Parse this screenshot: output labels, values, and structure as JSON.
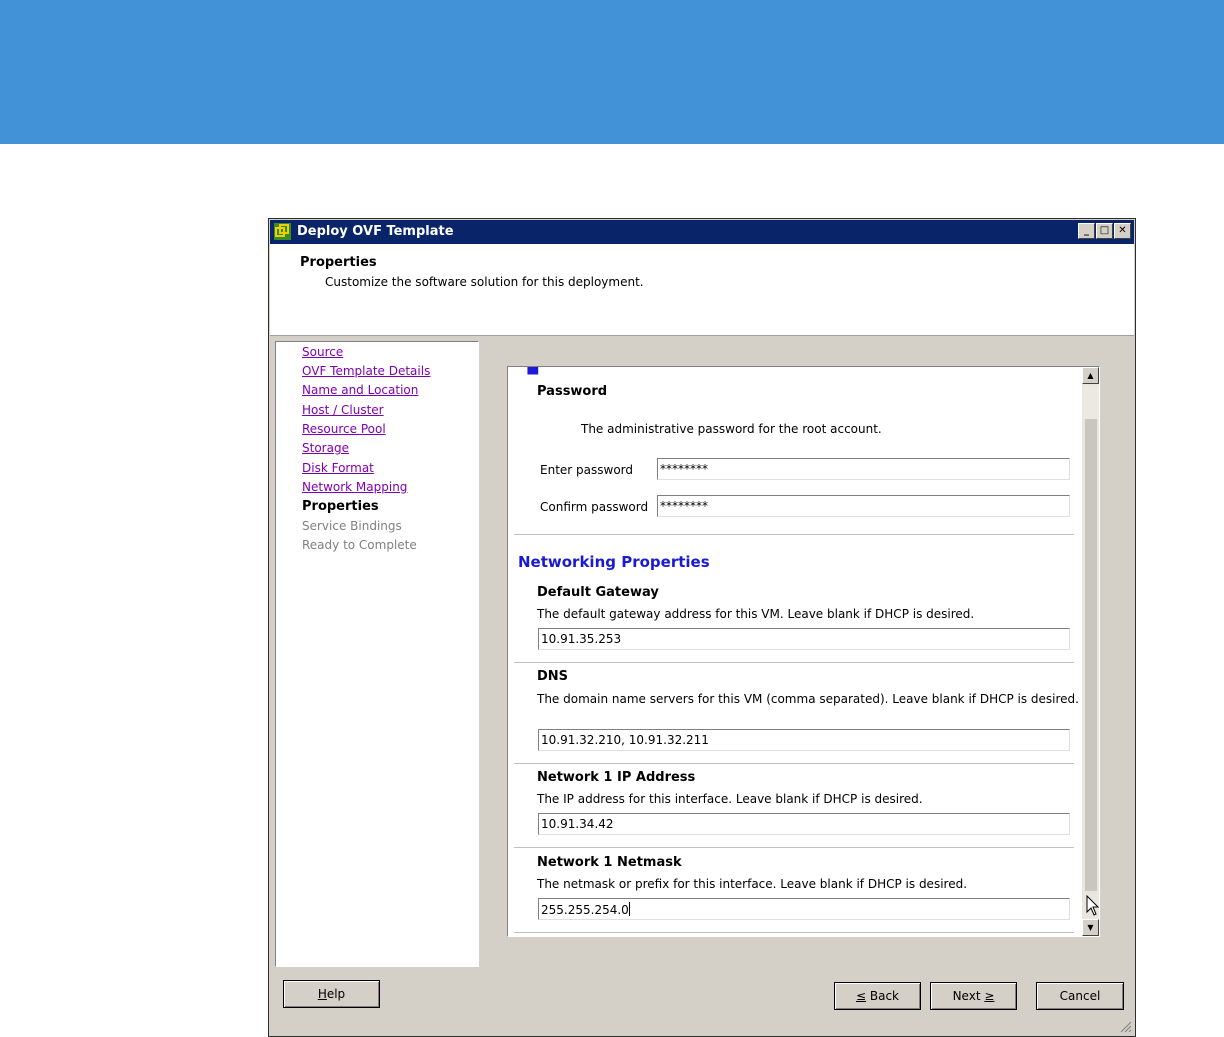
{
  "window": {
    "title": "Deploy OVF Template"
  },
  "titlebar": {
    "minimize": "_",
    "maximize": "□",
    "close": "✕"
  },
  "header": {
    "title": "Properties",
    "subtitle": "Customize the software solution for this deployment."
  },
  "nav": {
    "items": [
      {
        "label": "Source",
        "state": "visited"
      },
      {
        "label": "OVF Template Details",
        "state": "visited"
      },
      {
        "label": "Name and Location",
        "state": "visited"
      },
      {
        "label": "Host / Cluster",
        "state": "visited"
      },
      {
        "label": "Resource Pool",
        "state": "visited"
      },
      {
        "label": "Storage",
        "state": "visited"
      },
      {
        "label": "Disk Format",
        "state": "visited"
      },
      {
        "label": "Network Mapping",
        "state": "visited"
      },
      {
        "label": "Properties",
        "state": "current"
      },
      {
        "label": "Service Bindings",
        "state": "pending"
      },
      {
        "label": "Ready to Complete",
        "state": "pending"
      }
    ]
  },
  "password": {
    "title": "Password",
    "description": "The administrative password for the root account.",
    "enter_label": "Enter password",
    "enter_value": "********",
    "confirm_label": "Confirm password",
    "confirm_value": "********"
  },
  "networking": {
    "section_title": "Networking Properties",
    "gateway": {
      "title": "Default Gateway",
      "description": "The default gateway address for this VM. Leave blank if DHCP is desired.",
      "value": "10.91.35.253"
    },
    "dns": {
      "title": "DNS",
      "description": "The domain name servers for this VM (comma separated). Leave blank if DHCP is desired.",
      "value": "10.91.32.210, 10.91.32.211"
    },
    "ip": {
      "title": "Network 1 IP Address",
      "description": "The IP address for this interface. Leave blank if DHCP is desired.",
      "value": "10.91.34.42"
    },
    "netmask": {
      "title": "Network 1 Netmask",
      "description": "The netmask or prefix for this interface. Leave blank if DHCP is desired.",
      "value": "255.255.254.0"
    }
  },
  "buttons": {
    "help_u": "H",
    "help_rest": "elp",
    "back_u": "≤",
    "back_rest": " Back",
    "next_pre": "Next ",
    "next_u": "≥",
    "cancel": "Cancel"
  },
  "colors": {
    "banner": "#4192d6",
    "titlebar": "#0a246a",
    "link": "#7f00b2",
    "section": "#1a1ad6"
  }
}
